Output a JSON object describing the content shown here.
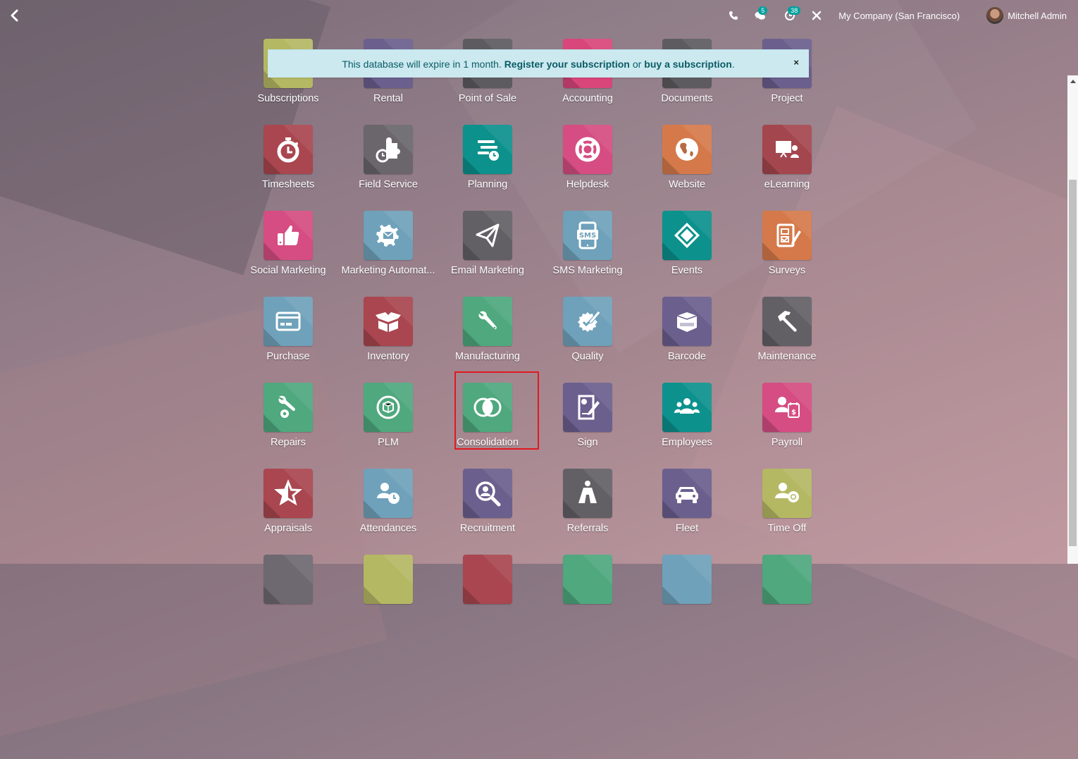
{
  "topbar": {
    "back_label": "Back",
    "systray": {
      "phone_icon": "phone-icon",
      "messages_icon": "chat-icon",
      "messages_count": "5",
      "activities_icon": "clock-icon",
      "activities_count": "38",
      "debug_icon": "tools-icon",
      "company": "My Company (San Francisco)",
      "user_name": "Mitchell Admin"
    }
  },
  "banner": {
    "text": "This database will expire in 1 month.",
    "register_link": "Register your subscription",
    "or": "or",
    "buy_link": "buy a subscription",
    "period": ".",
    "close": "×"
  },
  "apps": [
    {
      "label": "Subscriptions",
      "icon": "subscriptions-icon",
      "color": "#b5b863"
    },
    {
      "label": "Rental",
      "icon": "rental-icon",
      "color": "#6b5f8e"
    },
    {
      "label": "Point of Sale",
      "icon": "pos-icon",
      "color": "#5d5b5f"
    },
    {
      "label": "Accounting",
      "icon": "accounting-icon",
      "color": "#d8467a"
    },
    {
      "label": "Documents",
      "icon": "documents-icon",
      "color": "#5d5b5f"
    },
    {
      "label": "Project",
      "icon": "project-icon",
      "color": "#6b5f8e"
    },
    {
      "label": "Timesheets",
      "icon": "stopwatch-icon",
      "color": "#a9464f"
    },
    {
      "label": "Field Service",
      "icon": "puzzle-icon",
      "color": "#6a666c"
    },
    {
      "label": "Planning",
      "icon": "planning-icon",
      "color": "#0c918d"
    },
    {
      "label": "Helpdesk",
      "icon": "lifebuoy-icon",
      "color": "#d54d82"
    },
    {
      "label": "Website",
      "icon": "globe-icon",
      "color": "#d5794a"
    },
    {
      "label": "eLearning",
      "icon": "presentation-icon",
      "color": "#a4464e"
    },
    {
      "label": "Social Marketing",
      "icon": "thumbs-up-icon",
      "color": "#d54d82"
    },
    {
      "label": "Marketing Automat...",
      "icon": "gear-mail-icon",
      "color": "#6fa1ba"
    },
    {
      "label": "Email Marketing",
      "icon": "paper-plane-icon",
      "color": "#626065"
    },
    {
      "label": "SMS Marketing",
      "icon": "sms-icon",
      "color": "#6fa1ba"
    },
    {
      "label": "Events",
      "icon": "ticket-icon",
      "color": "#0c918d"
    },
    {
      "label": "Surveys",
      "icon": "survey-icon",
      "color": "#d5794a"
    },
    {
      "label": "Purchase",
      "icon": "credit-card-icon",
      "color": "#6fa1ba"
    },
    {
      "label": "Inventory",
      "icon": "box-icon",
      "color": "#a9464f"
    },
    {
      "label": "Manufacturing",
      "icon": "wrench-icon",
      "color": "#4fa87e"
    },
    {
      "label": "Quality",
      "icon": "quality-badge-icon",
      "color": "#6fa1ba"
    },
    {
      "label": "Barcode",
      "icon": "barcode-box-icon",
      "color": "#6b5f8e"
    },
    {
      "label": "Maintenance",
      "icon": "hammer-icon",
      "color": "#626065"
    },
    {
      "label": "Repairs",
      "icon": "repair-icon",
      "color": "#4fa87e"
    },
    {
      "label": "PLM",
      "icon": "cycle-box-icon",
      "color": "#4fa87e"
    },
    {
      "label": "Consolidation",
      "icon": "venn-icon",
      "color": "#4fa87e"
    },
    {
      "label": "Sign",
      "icon": "sign-icon",
      "color": "#6b5f8e"
    },
    {
      "label": "Employees",
      "icon": "people-icon",
      "color": "#0c918d"
    },
    {
      "label": "Payroll",
      "icon": "payroll-icon",
      "color": "#d54d82"
    },
    {
      "label": "Appraisals",
      "icon": "star-icon",
      "color": "#a9464f"
    },
    {
      "label": "Attendances",
      "icon": "user-clock-icon",
      "color": "#6fa1ba"
    },
    {
      "label": "Recruitment",
      "icon": "search-user-icon",
      "color": "#6b5f8e"
    },
    {
      "label": "Referrals",
      "icon": "hero-icon",
      "color": "#626065"
    },
    {
      "label": "Fleet",
      "icon": "car-icon",
      "color": "#6b5f8e"
    },
    {
      "label": "Time Off",
      "icon": "user-gear-icon",
      "color": "#b5b863"
    },
    {
      "label": "",
      "icon": "app-icon",
      "color": "#6e6870"
    },
    {
      "label": "",
      "icon": "app-icon",
      "color": "#b5b863"
    },
    {
      "label": "",
      "icon": "app-icon",
      "color": "#a9464f"
    },
    {
      "label": "",
      "icon": "app-icon",
      "color": "#4fa87e"
    },
    {
      "label": "",
      "icon": "app-icon",
      "color": "#6fa1ba"
    },
    {
      "label": "",
      "icon": "app-icon",
      "color": "#4fa87e"
    }
  ],
  "highlighted_app": "Consolidation"
}
